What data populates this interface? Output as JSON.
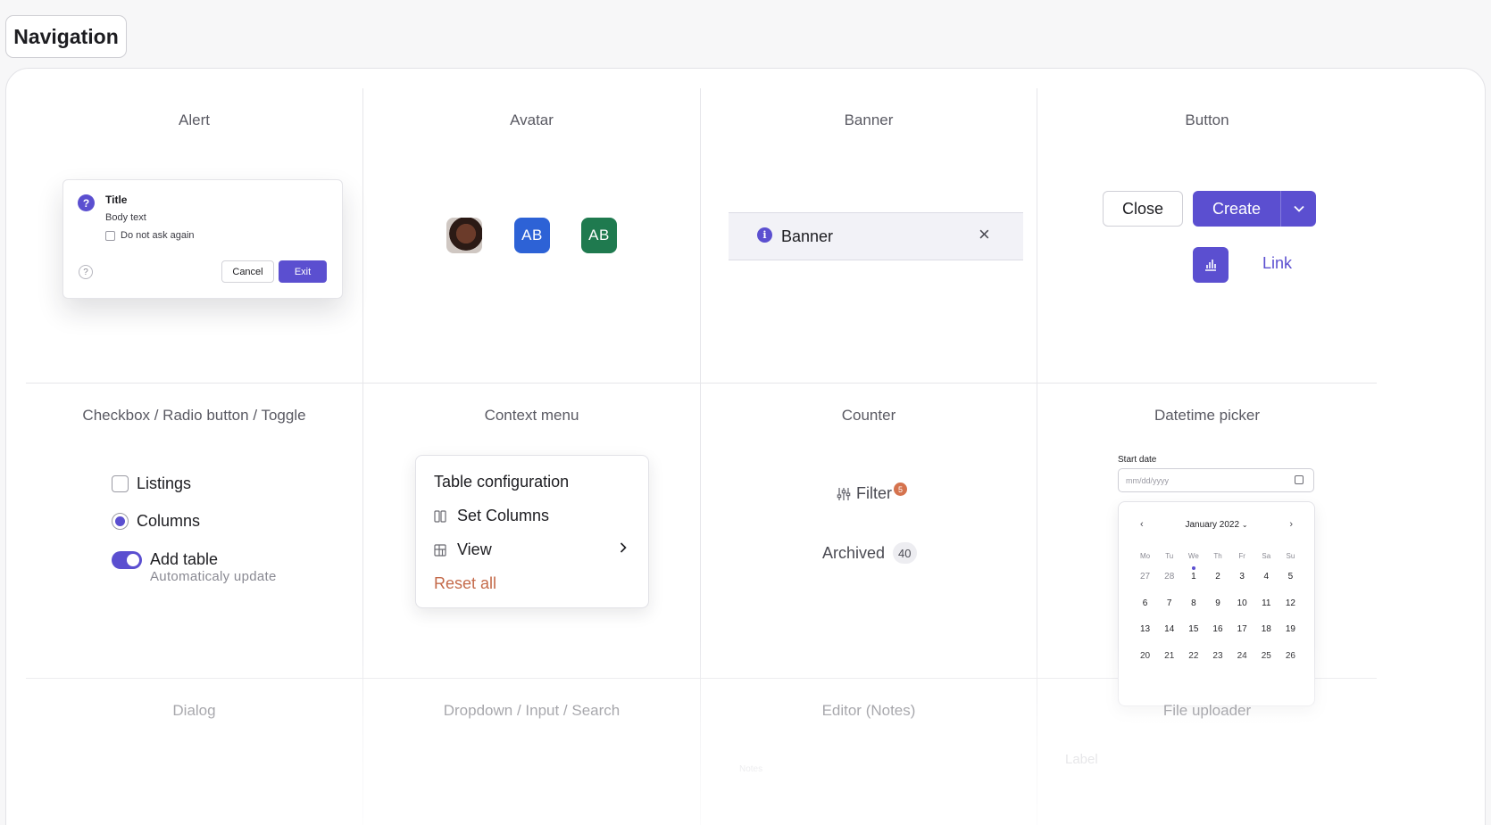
{
  "header": {
    "title": "Navigation"
  },
  "cells": {
    "alert": {
      "title": "Alert"
    },
    "avatar": {
      "title": "Avatar"
    },
    "banner": {
      "title": "Banner"
    },
    "button": {
      "title": "Button"
    },
    "checkbox": {
      "title": "Checkbox / Radio button / Toggle"
    },
    "context_menu": {
      "title": "Context menu"
    },
    "counter": {
      "title": "Counter"
    },
    "datetime": {
      "title": "Datetime picker"
    },
    "dialog": {
      "title": "Dialog"
    },
    "dropdown": {
      "title": "Dropdown / Input / Search"
    },
    "editor": {
      "title": "Editor (Notes)"
    },
    "uploader": {
      "title": "File uploader"
    }
  },
  "alert": {
    "title": "Title",
    "body": "Body text",
    "checkbox_label": "Do not ask again",
    "help": "?",
    "q": "?",
    "cancel": "Cancel",
    "exit": "Exit"
  },
  "avatar": {
    "initials_blue": "AB",
    "initials_green": "AB"
  },
  "banner": {
    "text": "Banner",
    "info": "i",
    "close": "×"
  },
  "buttons": {
    "close": "Close",
    "create": "Create",
    "link": "Link"
  },
  "checkbox": {
    "listings": "Listings",
    "columns": "Columns",
    "add_table": "Add table",
    "add_table_sub": "Automaticaly update"
  },
  "context_menu": {
    "header": "Table configuration",
    "set_columns": "Set Columns",
    "view": "View",
    "reset": "Reset all"
  },
  "counter": {
    "filter": "Filter",
    "filter_badge": "5",
    "archived": "Archived",
    "archived_count": "40"
  },
  "datepicker": {
    "label": "Start date",
    "placeholder": "mm/dd/yyyy",
    "month": "January 2022",
    "dow": [
      "Mo",
      "Tu",
      "We",
      "Th",
      "Fr",
      "Sa",
      "Su"
    ],
    "days": [
      [
        "27",
        "28",
        "1",
        "2",
        "3",
        "4",
        "5"
      ],
      [
        "6",
        "7",
        "8",
        "9",
        "10",
        "11",
        "12"
      ],
      [
        "13",
        "14",
        "15",
        "16",
        "17",
        "18",
        "19"
      ],
      [
        "20",
        "21",
        "22",
        "23",
        "24",
        "25",
        "26"
      ]
    ]
  },
  "bottom": {
    "editor_hint": "Notes",
    "uploader_label": "Label"
  },
  "colors": {
    "accent": "#5b4fd0",
    "avatar_blue": "#2d62d6",
    "avatar_green": "#1f7a4f",
    "reset": "#c46a4a",
    "badge": "#d5734e"
  }
}
